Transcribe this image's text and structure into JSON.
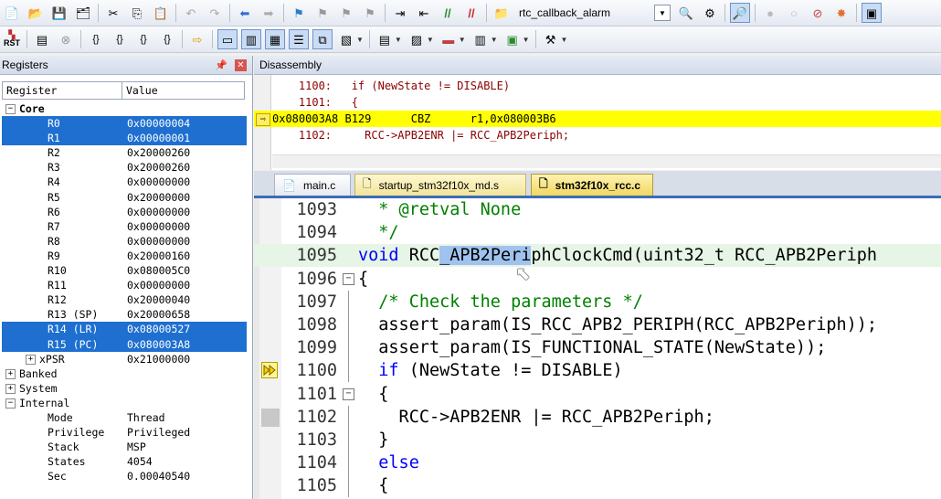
{
  "toolbar1": {
    "target_name": "rtc_callback_alarm"
  },
  "toolbar2": {
    "rst_label": "RST"
  },
  "registers": {
    "title": "Registers",
    "col_register": "Register",
    "col_value": "Value",
    "core_label": "Core",
    "rows": [
      {
        "name": "R0",
        "value": "0x00000004"
      },
      {
        "name": "R1",
        "value": "0x00000001"
      },
      {
        "name": "R2",
        "value": "0x20000260"
      },
      {
        "name": "R3",
        "value": "0x20000260"
      },
      {
        "name": "R4",
        "value": "0x00000000"
      },
      {
        "name": "R5",
        "value": "0x20000000"
      },
      {
        "name": "R6",
        "value": "0x00000000"
      },
      {
        "name": "R7",
        "value": "0x00000000"
      },
      {
        "name": "R8",
        "value": "0x00000000"
      },
      {
        "name": "R9",
        "value": "0x20000160"
      },
      {
        "name": "R10",
        "value": "0x080005C0"
      },
      {
        "name": "R11",
        "value": "0x00000000"
      },
      {
        "name": "R12",
        "value": "0x20000040"
      },
      {
        "name": "R13 (SP)",
        "value": "0x20000658"
      },
      {
        "name": "R14 (LR)",
        "value": "0x08000527"
      },
      {
        "name": "R15 (PC)",
        "value": "0x080003A8"
      },
      {
        "name": "xPSR",
        "value": "0x21000000"
      }
    ],
    "banked_label": "Banked",
    "system_label": "System",
    "internal_label": "Internal",
    "internal": [
      {
        "name": "Mode",
        "value": "Thread"
      },
      {
        "name": "Privilege",
        "value": "Privileged"
      },
      {
        "name": "Stack",
        "value": "MSP"
      },
      {
        "name": "States",
        "value": "4054"
      },
      {
        "name": "Sec",
        "value": "0.00040540"
      }
    ]
  },
  "disassembly": {
    "title": "Disassembly",
    "lines": [
      {
        "text": "    1100:   if (NewState != DISABLE)"
      },
      {
        "text": "    1101:   {"
      },
      {
        "text": "0x080003A8 B129      CBZ      r1,0x080003B6"
      },
      {
        "text": "    1102:     RCC->APB2ENR |= RCC_APB2Periph;"
      }
    ]
  },
  "tabs": [
    {
      "label": "main.c"
    },
    {
      "label": "startup_stm32f10x_md.s"
    },
    {
      "label": "stm32f10x_rcc.c"
    }
  ],
  "editor": {
    "lines": [
      {
        "num": "1093",
        "pre": "  * @retval None",
        "rest": ""
      },
      {
        "num": "1094",
        "pre": "  */",
        "rest": ""
      },
      {
        "num": "1095",
        "kw": "void",
        "a": " RCC",
        "sel": "_APB2Peri",
        "b": "phClockCmd(uint32_t RCC_APB2Periph"
      },
      {
        "num": "1096",
        "text": "{"
      },
      {
        "num": "1097",
        "comment": "  /* Check the parameters */"
      },
      {
        "num": "1098",
        "text": "  assert_param(IS_RCC_APB2_PERIPH(RCC_APB2Periph));"
      },
      {
        "num": "1099",
        "text": "  assert_param(IS_FUNCTIONAL_STATE(NewState));"
      },
      {
        "num": "1100",
        "kw": "if",
        "indent": "  ",
        "rest": " (NewState != DISABLE)"
      },
      {
        "num": "1101",
        "text": "  {"
      },
      {
        "num": "1102",
        "text": "    RCC->APB2ENR |= RCC_APB2Periph;"
      },
      {
        "num": "1103",
        "text": "  }"
      },
      {
        "num": "1104",
        "kw": "else",
        "indent": "  ",
        "rest": ""
      },
      {
        "num": "1105",
        "text": "  {"
      }
    ]
  }
}
